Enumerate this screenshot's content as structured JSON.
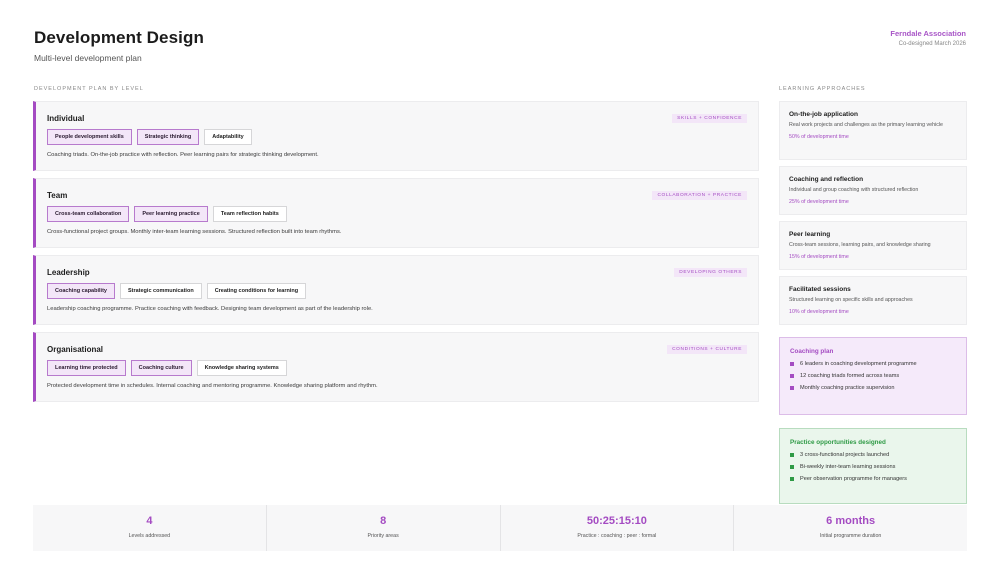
{
  "header": {
    "title": "Development Design",
    "subtitle": "Multi-level development plan",
    "org_name": "Ferndale Association",
    "org_date": "Co-designed March 2026"
  },
  "sections": {
    "levels_label": "Development plan by level",
    "approaches_label": "Learning approaches"
  },
  "levels": [
    {
      "title": "Individual",
      "badge": "Skills + confidence",
      "chips": [
        {
          "label": "People development skills",
          "highlight": true
        },
        {
          "label": "Strategic thinking",
          "highlight": true
        },
        {
          "label": "Adaptability",
          "highlight": false
        }
      ],
      "description": "Coaching triads. On-the-job practice with reflection. Peer learning pairs for strategic thinking development."
    },
    {
      "title": "Team",
      "badge": "Collaboration + practice",
      "chips": [
        {
          "label": "Cross-team collaboration",
          "highlight": true
        },
        {
          "label": "Peer learning practice",
          "highlight": true
        },
        {
          "label": "Team reflection habits",
          "highlight": false
        }
      ],
      "description": "Cross-functional project groups. Monthly inter-team learning sessions. Structured reflection built into team rhythms."
    },
    {
      "title": "Leadership",
      "badge": "Developing others",
      "chips": [
        {
          "label": "Coaching capability",
          "highlight": true
        },
        {
          "label": "Strategic communication",
          "highlight": false
        },
        {
          "label": "Creating conditions for learning",
          "highlight": false
        }
      ],
      "description": "Leadership coaching programme. Practice coaching with feedback. Designing team development as part of the leadership role."
    },
    {
      "title": "Organisational",
      "badge": "Conditions + culture",
      "chips": [
        {
          "label": "Learning time protected",
          "highlight": true
        },
        {
          "label": "Coaching culture",
          "highlight": true
        },
        {
          "label": "Knowledge sharing systems",
          "highlight": false
        }
      ],
      "description": "Protected development time in schedules. Internal coaching and mentoring programme. Knowledge sharing platform and rhythm."
    }
  ],
  "approaches": [
    {
      "title": "On-the-job application",
      "description": "Real work projects and challenges as the primary learning vehicle",
      "meta": "50% of development time"
    },
    {
      "title": "Coaching and reflection",
      "description": "Individual and group coaching with structured reflection",
      "meta": "25% of development time"
    },
    {
      "title": "Peer learning",
      "description": "Cross-team sessions, learning pairs, and knowledge sharing",
      "meta": "15% of development time"
    },
    {
      "title": "Facilitated sessions",
      "description": "Structured learning on specific skills and approaches",
      "meta": "10% of development time"
    }
  ],
  "coaching_plan": {
    "title": "Coaching plan",
    "items": [
      "6 leaders in coaching development programme",
      "12 coaching triads formed across teams",
      "Monthly coaching practice supervision"
    ]
  },
  "practice": {
    "title": "Practice opportunities designed",
    "items": [
      "3 cross-functional projects launched",
      "Bi-weekly inter-team learning sessions",
      "Peer observation programme for managers"
    ]
  },
  "stats": [
    {
      "value": "4",
      "label": "Levels addressed"
    },
    {
      "value": "8",
      "label": "Priority areas"
    },
    {
      "value": "50:25:15:10",
      "label": "Practice : coaching : peer : formal"
    },
    {
      "value": "6 months",
      "label": "Initial programme duration"
    }
  ]
}
